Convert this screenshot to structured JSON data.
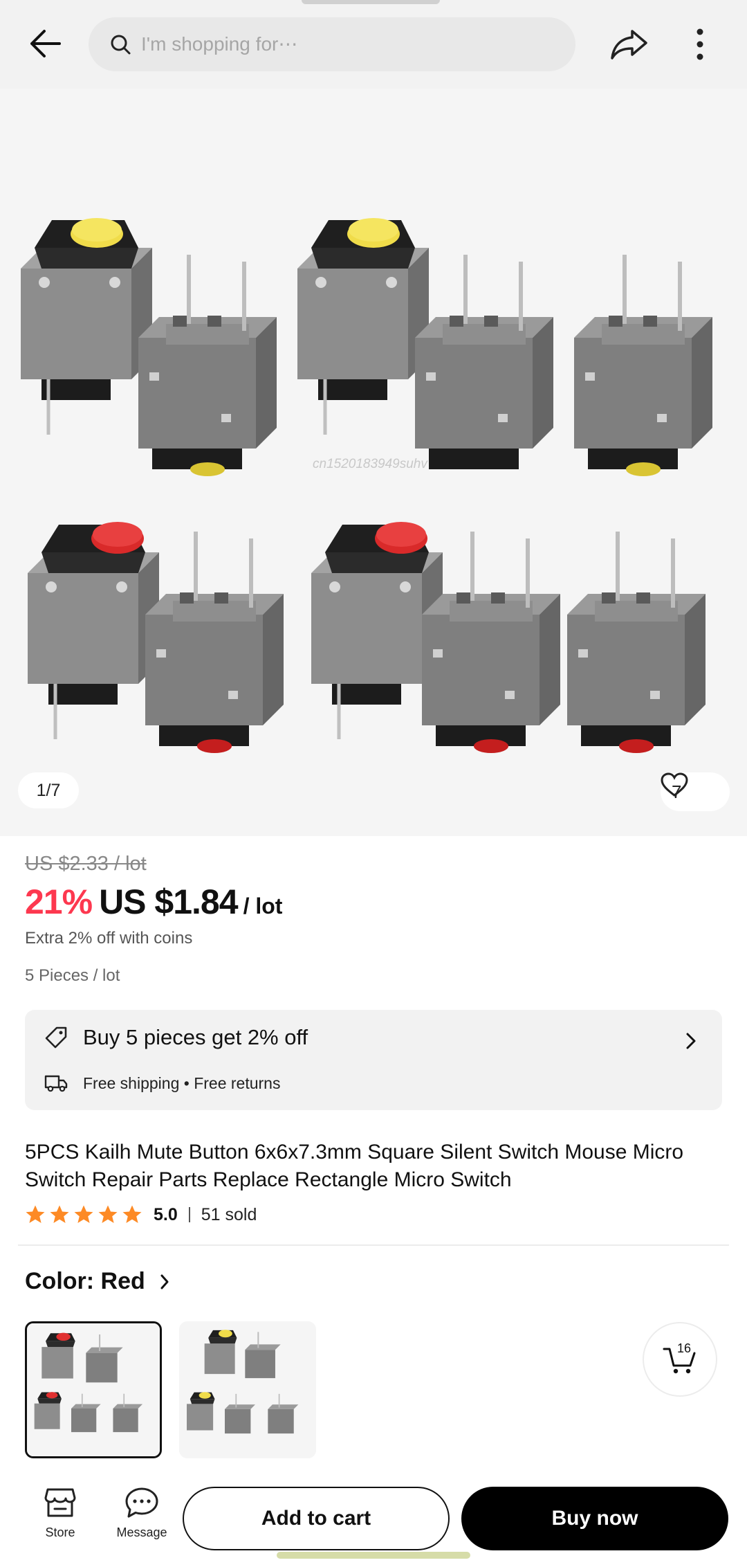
{
  "search": {
    "placeholder": "I'm shopping for⋯"
  },
  "gallery": {
    "watermark": "cn1520183949suhv",
    "page_indicator": "1/7",
    "wishlist_count": "7"
  },
  "price": {
    "original": "US $2.33 / lot",
    "discount": "21%",
    "current": "US $1.84",
    "unit": "/ lot",
    "coins_offer": "Extra 2% off with coins",
    "pieces": "5 Pieces / lot"
  },
  "promo": {
    "title": "Buy 5 pieces get 2% off",
    "shipping": "Free shipping • Free returns"
  },
  "product": {
    "title": "5PCS Kailh Mute Button 6x6x7.3mm Square Silent Switch Mouse Micro Switch Repair Parts Replace Rectangle Micro Switch",
    "rating": "5.0",
    "rating_stars": 5,
    "sold": "51 sold"
  },
  "color": {
    "label": "Color: Red",
    "options": [
      "red",
      "yellow"
    ],
    "selected": "red"
  },
  "cart": {
    "count": "16"
  },
  "bottom": {
    "store_label": "Store",
    "message_label": "Message",
    "add_to_cart": "Add to cart",
    "buy_now": "Buy now"
  },
  "colors": {
    "accent_red": "#fd384f",
    "star": "#fd8a25",
    "switch_gray": "#8a8a8a"
  }
}
